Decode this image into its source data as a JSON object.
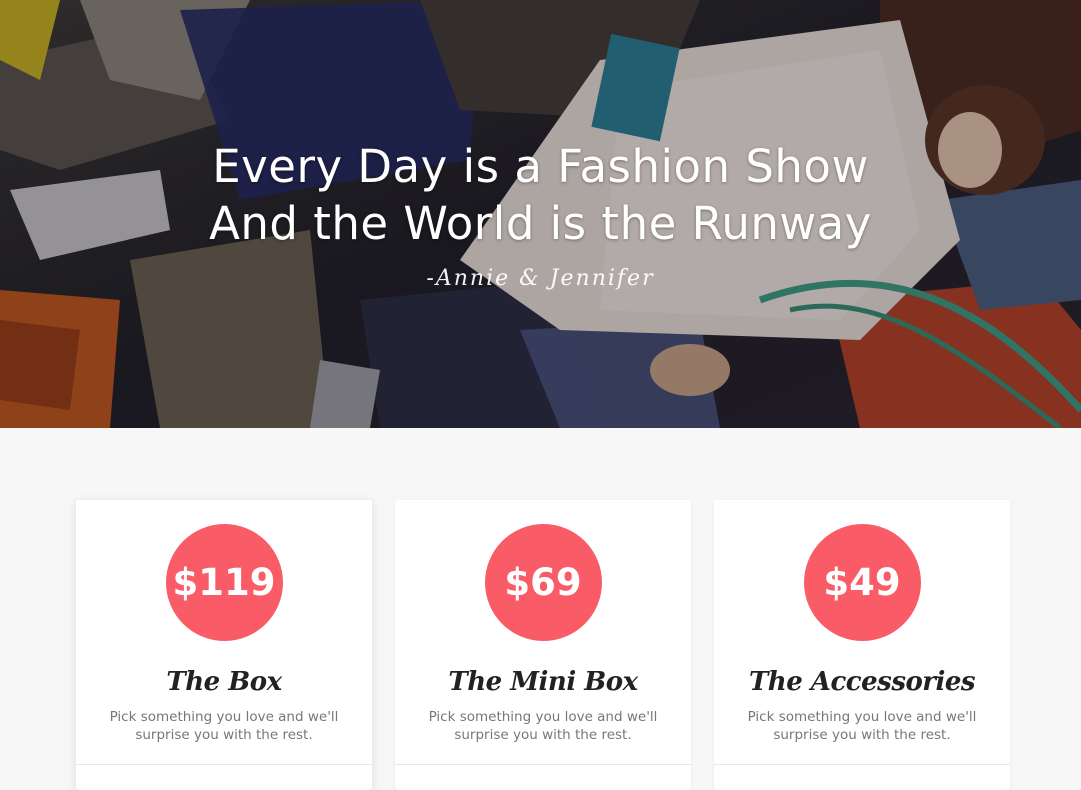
{
  "hero": {
    "line1": "Every Day is a Fashion Show",
    "line2": "And the World is the Runway",
    "signature": "-Annie & Jennifer"
  },
  "colors": {
    "accent": "#f95b67",
    "page_bg": "#f7f7f7",
    "card_bg": "#ffffff"
  },
  "plans": [
    {
      "price": "$119",
      "name": "The Box",
      "description": "Pick something you love and we'll surprise you with the rest."
    },
    {
      "price": "$69",
      "name": "The Mini Box",
      "description": "Pick something you love and we'll surprise you with the rest."
    },
    {
      "price": "$49",
      "name": "The Accessories",
      "description": "Pick something you love and we'll surprise you with the rest."
    }
  ]
}
